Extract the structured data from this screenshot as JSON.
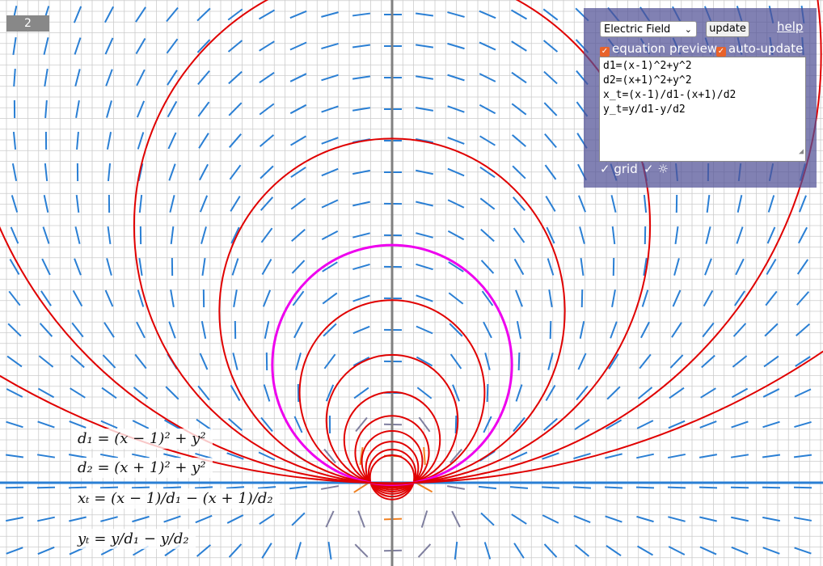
{
  "page_badge": "2",
  "panel": {
    "field_select": "Electric Field",
    "update_label": "update",
    "help_label": "help",
    "equation_preview_label": "equation preview",
    "auto_update_label": "auto-update",
    "equations_text": "d1=(x-1)^2+y^2\nd2=(x+1)^2+y^2\nx_t=(x-1)/d1-(x+1)/d2\ny_t=y/d1-y/d2",
    "grid_label": "grid",
    "sun_label": "☼",
    "equation_preview_checked": true,
    "auto_update_checked": true,
    "grid_checked": true,
    "sun_checked": true
  },
  "preview": {
    "eq1": "d₁ = (x − 1)² + y²",
    "eq2": "d₂ = (x + 1)² + y²",
    "eq3": "xₜ = (x − 1)/d₁ − (x + 1)/d₂",
    "eq4": "yₜ = y/d₁ − y/d₂"
  },
  "colors": {
    "curves": "#e00000",
    "highlight": "#ee00ee",
    "field_far": "#2a7fd4",
    "field_near": "#f08020",
    "grid": "#cccccc",
    "axis": "#808080",
    "panel": "#5a5a9a"
  }
}
